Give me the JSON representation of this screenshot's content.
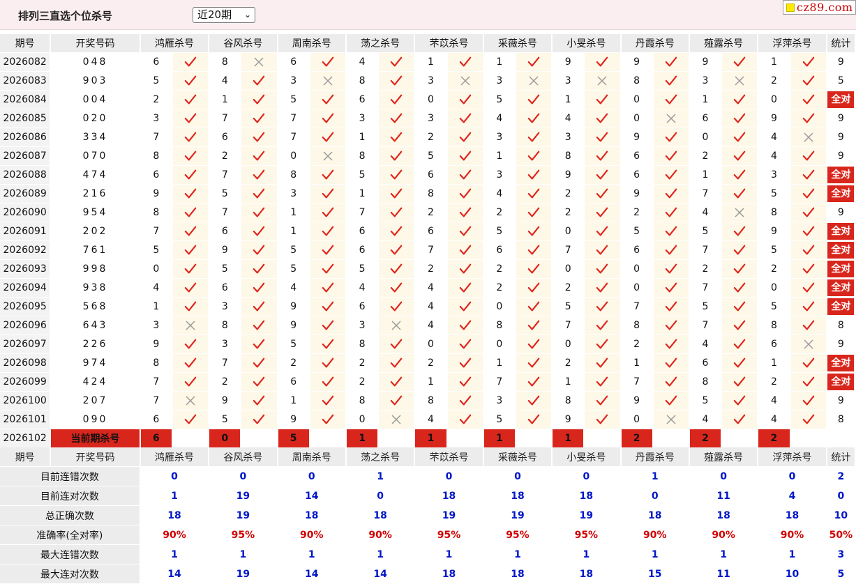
{
  "title": "排列三直选个位杀号",
  "period_select": {
    "value": "近20期",
    "arrow": "⌄"
  },
  "logo": {
    "text": "cz89.com"
  },
  "columns": {
    "term": "期号",
    "draw": "开奖号码",
    "experts": [
      "鸿雁杀号",
      "谷风杀号",
      "周南杀号",
      "荡之杀号",
      "芣苡杀号",
      "采薇杀号",
      "小旻杀号",
      "丹霞杀号",
      "薤露杀号",
      "浮萍杀号"
    ],
    "stat": "统计"
  },
  "all_correct_label": "全对",
  "rows": [
    {
      "term": "2026082",
      "draw": "048",
      "kills": [
        [
          6,
          1
        ],
        [
          8,
          0
        ],
        [
          6,
          1
        ],
        [
          4,
          1
        ],
        [
          1,
          1
        ],
        [
          1,
          1
        ],
        [
          9,
          1
        ],
        [
          9,
          1
        ],
        [
          9,
          1
        ],
        [
          1,
          1
        ]
      ],
      "stat": "9"
    },
    {
      "term": "2026083",
      "draw": "903",
      "kills": [
        [
          5,
          1
        ],
        [
          4,
          1
        ],
        [
          3,
          0
        ],
        [
          8,
          1
        ],
        [
          3,
          0
        ],
        [
          3,
          0
        ],
        [
          3,
          0
        ],
        [
          8,
          1
        ],
        [
          3,
          0
        ],
        [
          2,
          1
        ]
      ],
      "stat": "5"
    },
    {
      "term": "2026084",
      "draw": "004",
      "kills": [
        [
          2,
          1
        ],
        [
          1,
          1
        ],
        [
          5,
          1
        ],
        [
          6,
          1
        ],
        [
          0,
          1
        ],
        [
          5,
          1
        ],
        [
          1,
          1
        ],
        [
          0,
          1
        ],
        [
          1,
          1
        ],
        [
          0,
          1
        ]
      ],
      "stat": "全对"
    },
    {
      "term": "2026085",
      "draw": "020",
      "kills": [
        [
          3,
          1
        ],
        [
          7,
          1
        ],
        [
          7,
          1
        ],
        [
          3,
          1
        ],
        [
          3,
          1
        ],
        [
          4,
          1
        ],
        [
          4,
          1
        ],
        [
          0,
          0
        ],
        [
          6,
          1
        ],
        [
          9,
          1
        ]
      ],
      "stat": "9"
    },
    {
      "term": "2026086",
      "draw": "334",
      "kills": [
        [
          7,
          1
        ],
        [
          6,
          1
        ],
        [
          7,
          1
        ],
        [
          1,
          1
        ],
        [
          2,
          1
        ],
        [
          3,
          1
        ],
        [
          3,
          1
        ],
        [
          9,
          1
        ],
        [
          0,
          1
        ],
        [
          4,
          0
        ]
      ],
      "stat": "9"
    },
    {
      "term": "2026087",
      "draw": "070",
      "kills": [
        [
          8,
          1
        ],
        [
          2,
          1
        ],
        [
          0,
          0
        ],
        [
          8,
          1
        ],
        [
          5,
          1
        ],
        [
          1,
          1
        ],
        [
          8,
          1
        ],
        [
          6,
          1
        ],
        [
          2,
          1
        ],
        [
          4,
          1
        ]
      ],
      "stat": "9"
    },
    {
      "term": "2026088",
      "draw": "474",
      "kills": [
        [
          6,
          1
        ],
        [
          7,
          1
        ],
        [
          8,
          1
        ],
        [
          5,
          1
        ],
        [
          6,
          1
        ],
        [
          3,
          1
        ],
        [
          9,
          1
        ],
        [
          6,
          1
        ],
        [
          1,
          1
        ],
        [
          3,
          1
        ]
      ],
      "stat": "全对"
    },
    {
      "term": "2026089",
      "draw": "216",
      "kills": [
        [
          9,
          1
        ],
        [
          5,
          1
        ],
        [
          3,
          1
        ],
        [
          1,
          1
        ],
        [
          8,
          1
        ],
        [
          4,
          1
        ],
        [
          2,
          1
        ],
        [
          9,
          1
        ],
        [
          7,
          1
        ],
        [
          5,
          1
        ]
      ],
      "stat": "全对"
    },
    {
      "term": "2026090",
      "draw": "954",
      "kills": [
        [
          8,
          1
        ],
        [
          7,
          1
        ],
        [
          1,
          1
        ],
        [
          7,
          1
        ],
        [
          2,
          1
        ],
        [
          2,
          1
        ],
        [
          2,
          1
        ],
        [
          2,
          1
        ],
        [
          4,
          0
        ],
        [
          8,
          1
        ]
      ],
      "stat": "9"
    },
    {
      "term": "2026091",
      "draw": "202",
      "kills": [
        [
          7,
          1
        ],
        [
          6,
          1
        ],
        [
          1,
          1
        ],
        [
          6,
          1
        ],
        [
          6,
          1
        ],
        [
          5,
          1
        ],
        [
          0,
          1
        ],
        [
          5,
          1
        ],
        [
          5,
          1
        ],
        [
          9,
          1
        ]
      ],
      "stat": "全对"
    },
    {
      "term": "2026092",
      "draw": "761",
      "kills": [
        [
          5,
          1
        ],
        [
          9,
          1
        ],
        [
          5,
          1
        ],
        [
          6,
          1
        ],
        [
          7,
          1
        ],
        [
          6,
          1
        ],
        [
          7,
          1
        ],
        [
          6,
          1
        ],
        [
          7,
          1
        ],
        [
          5,
          1
        ]
      ],
      "stat": "全对"
    },
    {
      "term": "2026093",
      "draw": "998",
      "kills": [
        [
          0,
          1
        ],
        [
          5,
          1
        ],
        [
          5,
          1
        ],
        [
          5,
          1
        ],
        [
          2,
          1
        ],
        [
          2,
          1
        ],
        [
          0,
          1
        ],
        [
          0,
          1
        ],
        [
          2,
          1
        ],
        [
          2,
          1
        ]
      ],
      "stat": "全对"
    },
    {
      "term": "2026094",
      "draw": "938",
      "kills": [
        [
          4,
          1
        ],
        [
          6,
          1
        ],
        [
          4,
          1
        ],
        [
          4,
          1
        ],
        [
          4,
          1
        ],
        [
          2,
          1
        ],
        [
          2,
          1
        ],
        [
          0,
          1
        ],
        [
          7,
          1
        ],
        [
          0,
          1
        ]
      ],
      "stat": "全对"
    },
    {
      "term": "2026095",
      "draw": "568",
      "kills": [
        [
          1,
          1
        ],
        [
          3,
          1
        ],
        [
          9,
          1
        ],
        [
          6,
          1
        ],
        [
          4,
          1
        ],
        [
          0,
          1
        ],
        [
          5,
          1
        ],
        [
          7,
          1
        ],
        [
          5,
          1
        ],
        [
          5,
          1
        ]
      ],
      "stat": "全对"
    },
    {
      "term": "2026096",
      "draw": "643",
      "kills": [
        [
          3,
          0
        ],
        [
          8,
          1
        ],
        [
          9,
          1
        ],
        [
          3,
          0
        ],
        [
          4,
          1
        ],
        [
          8,
          1
        ],
        [
          7,
          1
        ],
        [
          8,
          1
        ],
        [
          7,
          1
        ],
        [
          8,
          1
        ]
      ],
      "stat": "8"
    },
    {
      "term": "2026097",
      "draw": "226",
      "kills": [
        [
          9,
          1
        ],
        [
          3,
          1
        ],
        [
          5,
          1
        ],
        [
          8,
          1
        ],
        [
          0,
          1
        ],
        [
          0,
          1
        ],
        [
          0,
          1
        ],
        [
          2,
          1
        ],
        [
          4,
          1
        ],
        [
          6,
          0
        ]
      ],
      "stat": "9"
    },
    {
      "term": "2026098",
      "draw": "974",
      "kills": [
        [
          8,
          1
        ],
        [
          7,
          1
        ],
        [
          2,
          1
        ],
        [
          2,
          1
        ],
        [
          2,
          1
        ],
        [
          1,
          1
        ],
        [
          2,
          1
        ],
        [
          1,
          1
        ],
        [
          6,
          1
        ],
        [
          1,
          1
        ]
      ],
      "stat": "全对"
    },
    {
      "term": "2026099",
      "draw": "424",
      "kills": [
        [
          7,
          1
        ],
        [
          2,
          1
        ],
        [
          6,
          1
        ],
        [
          2,
          1
        ],
        [
          1,
          1
        ],
        [
          7,
          1
        ],
        [
          1,
          1
        ],
        [
          7,
          1
        ],
        [
          8,
          1
        ],
        [
          2,
          1
        ]
      ],
      "stat": "全对"
    },
    {
      "term": "2026100",
      "draw": "207",
      "kills": [
        [
          7,
          0
        ],
        [
          9,
          1
        ],
        [
          1,
          1
        ],
        [
          8,
          1
        ],
        [
          8,
          1
        ],
        [
          3,
          1
        ],
        [
          8,
          1
        ],
        [
          9,
          1
        ],
        [
          5,
          1
        ],
        [
          4,
          1
        ]
      ],
      "stat": "9"
    },
    {
      "term": "2026101",
      "draw": "090",
      "kills": [
        [
          6,
          1
        ],
        [
          5,
          1
        ],
        [
          9,
          1
        ],
        [
          0,
          0
        ],
        [
          4,
          1
        ],
        [
          5,
          1
        ],
        [
          9,
          1
        ],
        [
          0,
          0
        ],
        [
          4,
          1
        ],
        [
          4,
          1
        ]
      ],
      "stat": "8"
    }
  ],
  "current": {
    "term": "2026102",
    "label": "当前期杀号",
    "kills": [
      "6",
      "0",
      "5",
      "1",
      "1",
      "1",
      "1",
      "2",
      "2",
      "2"
    ]
  },
  "summary": [
    {
      "label": "目前连错次数",
      "values": [
        "0",
        "0",
        "0",
        "1",
        "0",
        "0",
        "0",
        "1",
        "0",
        "0",
        "2"
      ]
    },
    {
      "label": "目前连对次数",
      "values": [
        "1",
        "19",
        "14",
        "0",
        "18",
        "18",
        "18",
        "0",
        "11",
        "4",
        "0"
      ]
    },
    {
      "label": "总正确次数",
      "values": [
        "18",
        "19",
        "18",
        "18",
        "19",
        "19",
        "19",
        "18",
        "18",
        "18",
        "10"
      ]
    },
    {
      "label": "准确率(全对率)",
      "values": [
        "90%",
        "95%",
        "90%",
        "90%",
        "95%",
        "95%",
        "95%",
        "90%",
        "90%",
        "90%",
        "50%"
      ],
      "rate": true
    },
    {
      "label": "最大连错次数",
      "values": [
        "1",
        "1",
        "1",
        "1",
        "1",
        "1",
        "1",
        "1",
        "1",
        "1",
        "3"
      ]
    },
    {
      "label": "最大连对次数",
      "values": [
        "14",
        "19",
        "14",
        "14",
        "18",
        "18",
        "18",
        "15",
        "11",
        "10",
        "5"
      ]
    }
  ],
  "colors": {
    "accent_red": "#d9261c",
    "check_red": "#e0241b",
    "cross_gray": "#9a9a9a",
    "value_blue": "#0016c8",
    "header_bg": "#ececec",
    "mark_bg": "#fdf8e8",
    "topbar_bg": "#fbeef0"
  }
}
